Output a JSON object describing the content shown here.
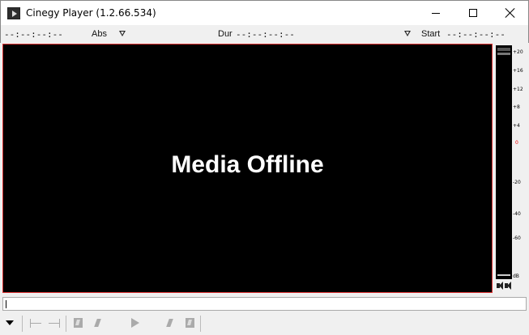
{
  "window": {
    "title": "Cinegy Player (1.2.66.534)"
  },
  "timebar": {
    "left_timecode": "--:--:--:--",
    "abs_label": "Abs",
    "dur_label": "Dur",
    "dur_timecode": "--:--:--:--",
    "start_label": "Start",
    "start_timecode": "--:--:--:--"
  },
  "video": {
    "status_text": "Media Offline",
    "background_color": "#000000",
    "border_color": "#d33333"
  },
  "audio_meter": {
    "scale": [
      "+20",
      "+16",
      "+12",
      "+8",
      "+4",
      "0",
      "-20",
      "-40",
      "-60",
      "dB"
    ],
    "zero_color": "#e00000"
  },
  "icons": {
    "app": "cinegy-player-icon",
    "speaker_left": "speaker-icon",
    "speaker_right": "speaker-icon"
  }
}
